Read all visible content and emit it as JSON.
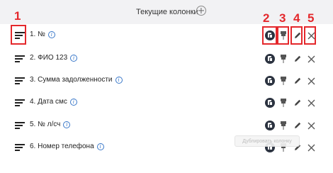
{
  "header": {
    "title": "Текущие колонки"
  },
  "rows": [
    {
      "label": "1. №"
    },
    {
      "label": "2. ФИО 123"
    },
    {
      "label": "3. Сумма задолженности"
    },
    {
      "label": "4. Дата смс"
    },
    {
      "label": "5. № л/сч"
    },
    {
      "label": "6. Номер телефона"
    }
  ],
  "annotations": [
    "1",
    "2",
    "3",
    "4",
    "5"
  ],
  "tooltip": {
    "text": "Дублировать колонку"
  },
  "colors": {
    "annotation": "#e4282c",
    "info": "#3a78c9",
    "header_bg": "#f2f2f4"
  },
  "icons": {
    "drag": "drag-handle-icon",
    "info": "info-icon",
    "duplicate": "duplicate-icon",
    "pin": "pin-icon",
    "edit": "pencil-icon",
    "delete": "close-icon",
    "add": "plus-circle-icon"
  }
}
